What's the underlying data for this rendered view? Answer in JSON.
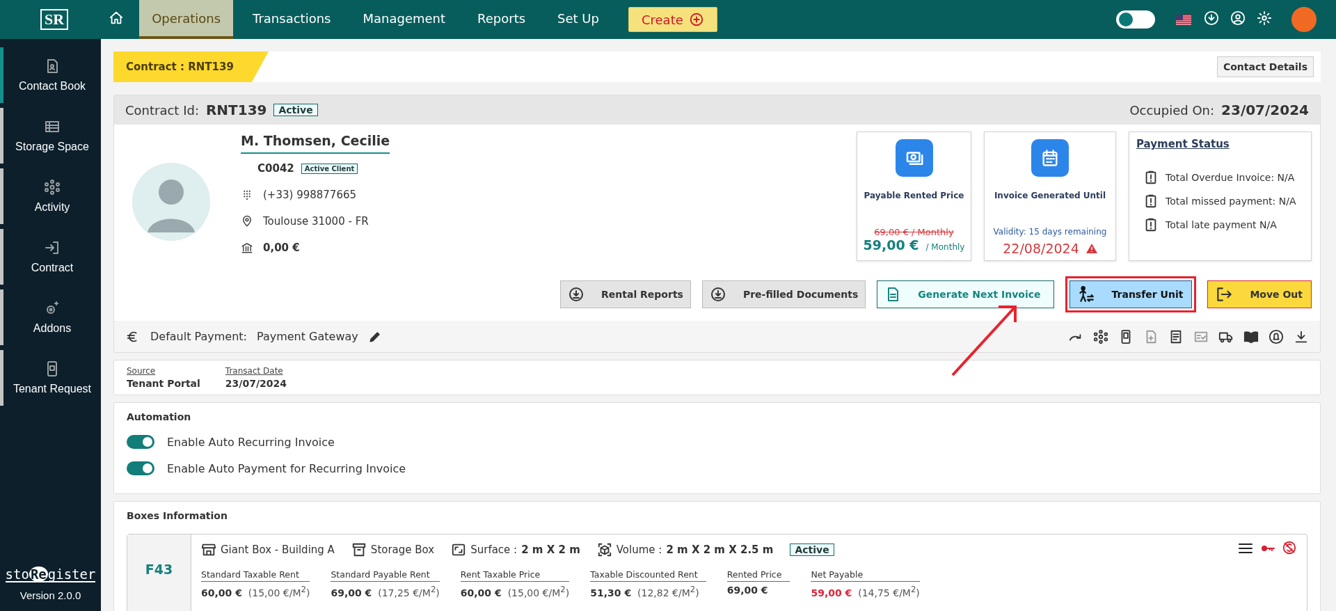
{
  "topbar": {
    "logo": "SR",
    "nav": [
      {
        "label": "Operations",
        "selected": true
      },
      {
        "label": "Transactions",
        "selected": false
      },
      {
        "label": "Management",
        "selected": false
      },
      {
        "label": "Reports",
        "selected": false
      },
      {
        "label": "Set Up",
        "selected": false
      }
    ],
    "create": "Create",
    "theme_toggle": {
      "on": false
    }
  },
  "sidebar": {
    "items": [
      {
        "label": "Contact Book",
        "selected": true
      },
      {
        "label": "Storage Space",
        "selected": false
      },
      {
        "label": "Activity",
        "selected": false
      },
      {
        "label": "Contract",
        "selected": false
      },
      {
        "label": "Addons",
        "selected": false
      },
      {
        "label": "Tenant Request",
        "selected": false
      }
    ],
    "brand": {
      "pre": "sto",
      "mark": "Re",
      "post": "gister"
    },
    "version": "Version 2.0.0"
  },
  "breadcrumb": "Contract : RNT139",
  "contact_details": "Contact Details",
  "contract": {
    "id_label": "Contract Id:",
    "id": "RNT139",
    "status": "Active",
    "occupied_label": "Occupied On:",
    "occupied": "23/07/2024",
    "client": {
      "name": "M. Thomsen, Cecilie",
      "code": "C0042",
      "status": "Active Client",
      "phone": "(+33) 998877665",
      "address": "Toulouse 31000 - FR",
      "balance": "0,00 €"
    },
    "price_card": {
      "title": "Payable Rented Price",
      "old": "69,00 € / Monthly",
      "price": "59,00 €",
      "period": "/ Monthly"
    },
    "invoice_card": {
      "title": "Invoice Generated Until",
      "validity": "Validity: 15 days remaining",
      "date": "22/08/2024",
      "warning": true
    },
    "payment_status": {
      "title": "Payment Status",
      "items": [
        "Total Overdue Invoice: N/A",
        "Total missed payment: N/A",
        "Total late payment N/A"
      ]
    },
    "actions": [
      {
        "label": "Rental Reports",
        "kind": "download",
        "highlighted": false
      },
      {
        "label": "Pre-filled Documents",
        "kind": "download",
        "highlighted": false
      },
      {
        "label": "Generate Next Invoice",
        "kind": "invoice",
        "highlighted": false
      },
      {
        "label": "Transfer Unit",
        "kind": "transfer",
        "highlighted": true
      },
      {
        "label": "Move Out",
        "kind": "moveout",
        "highlighted": false
      }
    ],
    "default_payment": {
      "label": "Default Payment:",
      "value": "Payment Gateway"
    }
  },
  "transaction": {
    "fields": [
      {
        "label": "Source",
        "value": "Tenant Portal"
      },
      {
        "label": "Transact Date",
        "value": "23/07/2024"
      }
    ]
  },
  "automation": {
    "title": "Automation",
    "toggles": [
      {
        "label": "Enable Auto Recurring Invoice",
        "on": true
      },
      {
        "label": "Enable Auto Payment for Recurring Invoice",
        "on": true
      }
    ]
  },
  "boxes": {
    "title": "Boxes Information",
    "items": [
      {
        "code": "F43",
        "type": "Giant Box - Building A",
        "category": "Storage Box",
        "surface_label": "Surface :",
        "surface": "2 m X 2 m",
        "volume_label": "Volume :",
        "volume": "2 m X 2 m X 2.5 m",
        "status": "Active",
        "prices": [
          {
            "label": "Standard Taxable Rent",
            "value": "60,00 €",
            "per_area": "(15,00 €/M$^{2}$)",
            "alert": false
          },
          {
            "label": "Standard Payable Rent",
            "value": "69,00 €",
            "per_area": "(17,25 €/M$^{2}$)",
            "alert": false
          },
          {
            "label": "Rent Taxable Price",
            "value": "60,00 €",
            "per_area": "(15,00 €/M$^{2}$)",
            "alert": false
          },
          {
            "label": "Taxable Discounted Rent",
            "value": "51,30 €",
            "per_area": "(12,82 €/M$^{2}$)",
            "alert": false
          },
          {
            "label": "Rented Price",
            "value": "69,00 €",
            "alert": false
          },
          {
            "label": "Net Payable",
            "value": "59,00 €",
            "per_area": "(14,75 €/M$^{2}$)",
            "alert": true
          }
        ]
      }
    ]
  }
}
